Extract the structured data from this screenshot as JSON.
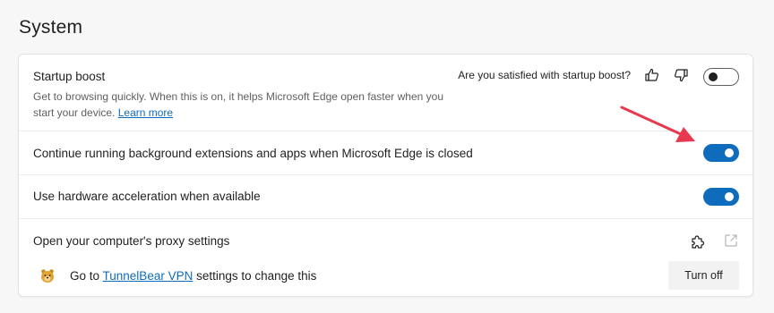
{
  "page": {
    "title": "System"
  },
  "startup_boost": {
    "title": "Startup boost",
    "description": "Get to browsing quickly. When this is on, it helps Microsoft Edge open faster when you start your device.",
    "learn_more": "Learn more",
    "question": "Are you satisfied with startup boost?",
    "thumbs_up_icon": "thumbs-up-icon",
    "thumbs_down_icon": "thumbs-down-icon",
    "toggle_state": "off"
  },
  "background_extensions": {
    "title": "Continue running background extensions and apps when Microsoft Edge is closed",
    "toggle_state": "on"
  },
  "hardware_acceleration": {
    "title": "Use hardware acceleration when available",
    "toggle_state": "on"
  },
  "proxy": {
    "title": "Open your computer's proxy settings",
    "extension_icon": "puzzle-piece-icon",
    "open_external_icon": "open-external-icon",
    "notice_prefix": "Go to ",
    "extension_name": "TunnelBear VPN",
    "notice_suffix": " settings to change this",
    "turn_off_label": "Turn off"
  },
  "colors": {
    "accent": "#0f6cbd",
    "annotation_arrow": "#e8384f"
  }
}
